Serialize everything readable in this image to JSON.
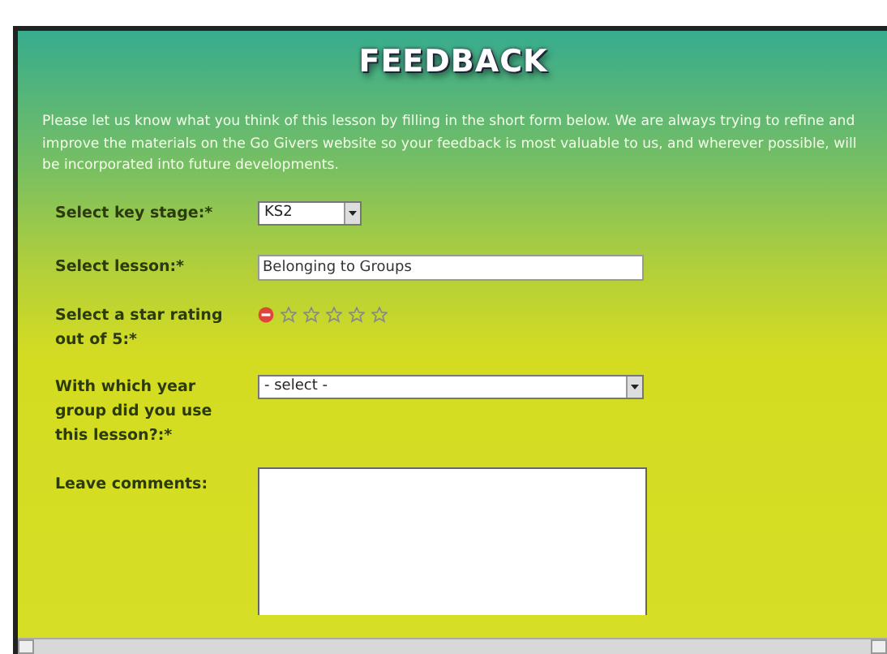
{
  "title": "FEEDBACK",
  "intro": "Please let us know what you think of this lesson by filling in the short form below. We are always trying to refine and improve the materials on the Go Givers website so your feedback is most valuable to us, and wherever possible, will be incorporated into future developments.",
  "fields": [
    {
      "kind": "select",
      "label": "Select key stage:*",
      "value": "KS2"
    },
    {
      "kind": "text",
      "label": "Select lesson:*",
      "value": "Belonging to Groups"
    },
    {
      "kind": "rating",
      "label": "Select a star rating out of 5:*",
      "stars": 0
    },
    {
      "kind": "select",
      "label": "With which year group did you use this lesson?:*",
      "value": "- select -"
    },
    {
      "kind": "textarea",
      "label": "Leave comments:"
    }
  ]
}
